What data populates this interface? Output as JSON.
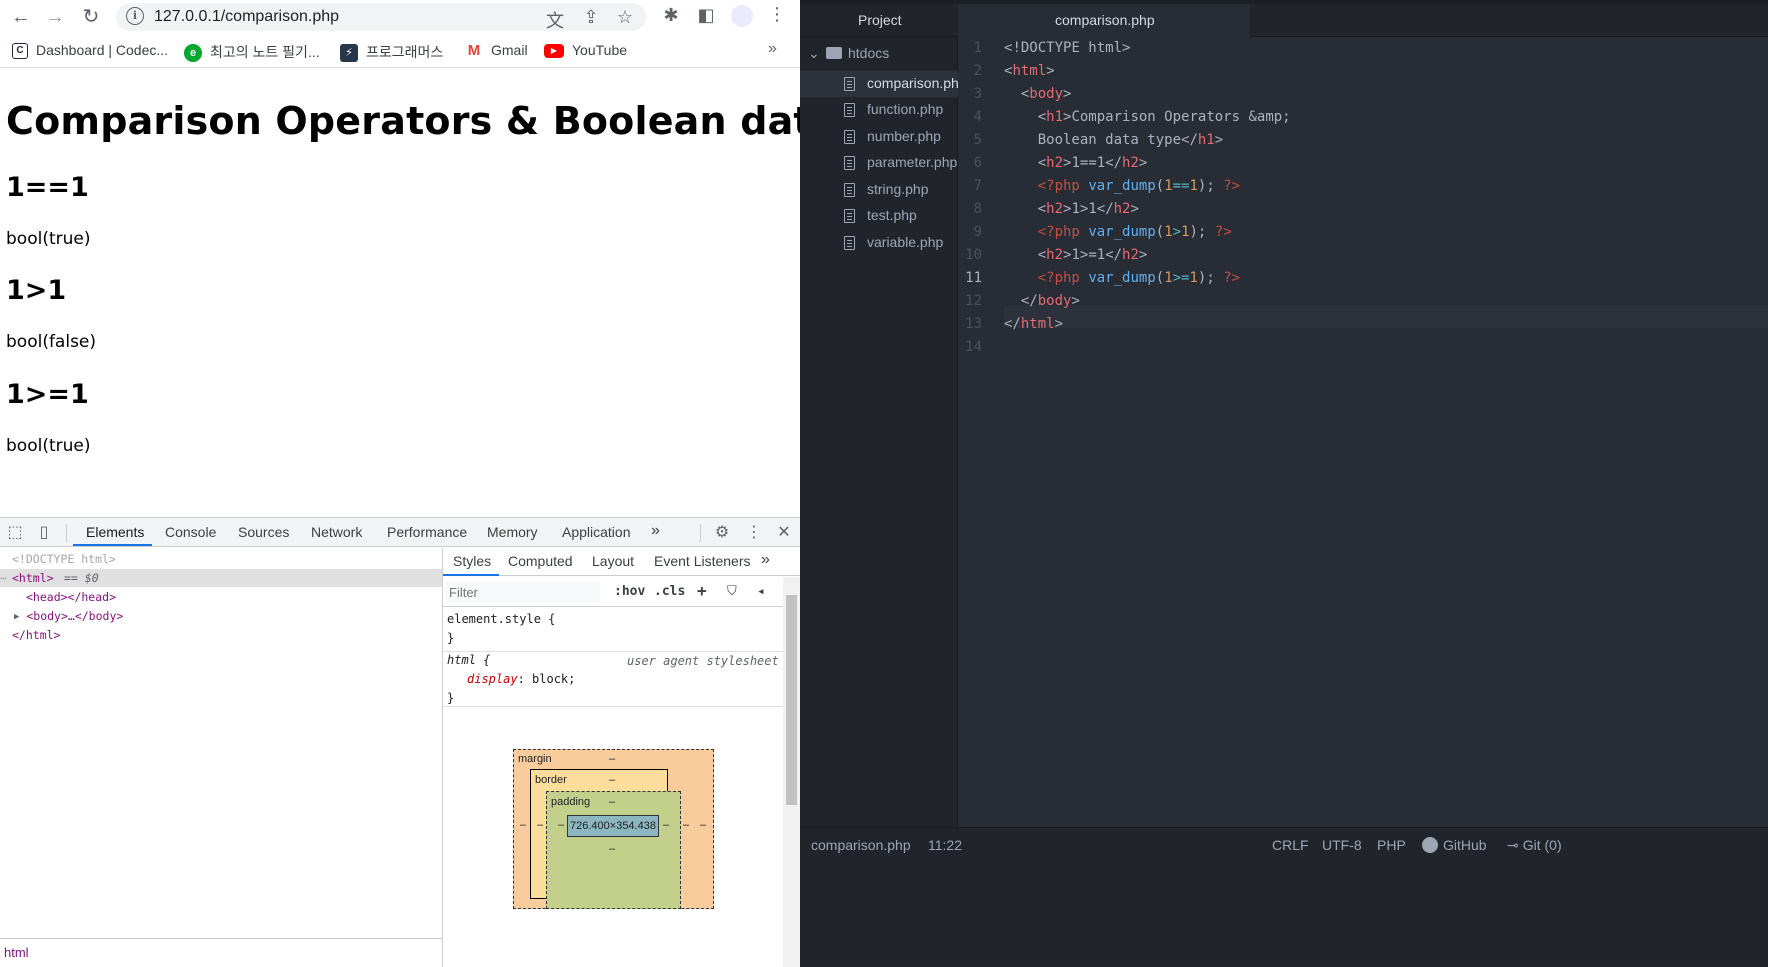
{
  "browser": {
    "url": "127.0.0.1/comparison.php",
    "bookmarks": [
      {
        "label": "Dashboard | Codec...",
        "icon": "codecademy-icon"
      },
      {
        "label": "최고의 노트 필기...",
        "icon": "evernote-icon"
      },
      {
        "label": "프로그래머스",
        "icon": "programmers-icon"
      },
      {
        "label": "Gmail",
        "icon": "gmail-icon"
      },
      {
        "label": "YouTube",
        "icon": "youtube-icon"
      }
    ],
    "bookmarks_more": "»"
  },
  "page": {
    "h1": "Comparison Operators & Boolean data type",
    "sections": [
      {
        "heading": "1==1",
        "output": "bool(true)"
      },
      {
        "heading": "1>1",
        "output": "bool(false)"
      },
      {
        "heading": "1>=1",
        "output": "bool(true)"
      }
    ]
  },
  "devtools": {
    "tabs": [
      "Elements",
      "Console",
      "Sources",
      "Network",
      "Performance",
      "Memory",
      "Application"
    ],
    "active_tab": "Elements",
    "tabs_more": "»",
    "dom": {
      "doctype": "<!DOCTYPE html>",
      "html_open": "<html>",
      "selected_marker": "== $0",
      "head": "<head></head>",
      "body": "<body>…</body>",
      "html_close": "</html>"
    },
    "breadcrumb": "html",
    "styles": {
      "tabs": [
        "Styles",
        "Computed",
        "Layout",
        "Event Listeners"
      ],
      "tabs_more": "»",
      "filter_placeholder": "Filter",
      "hov": ":hov",
      "cls": ".cls",
      "element_style_selector": "element.style {",
      "close_brace": "}",
      "rule_selector": "html {",
      "rule_source": "user agent stylesheet",
      "rule_prop": "display",
      "rule_value": "block;",
      "boxmodel": {
        "margin_label": "margin",
        "border_label": "border",
        "padding_label": "padding",
        "dash": "–",
        "content_size": "726.400×354.438"
      }
    }
  },
  "editor": {
    "panel_title": "Project",
    "active_tab": "comparison.php",
    "folder": "htdocs",
    "files": [
      "comparison.php",
      "function.php",
      "number.php",
      "parameter.php",
      "string.php",
      "test.php",
      "variable.php"
    ],
    "selected_file": "comparison.php",
    "line_numbers": [
      "1",
      "2",
      "3",
      "4",
      "5",
      "6",
      "7",
      "8",
      "9",
      "10",
      "11",
      "12",
      "13",
      "14"
    ],
    "current_line": "11",
    "code": [
      "<!DOCTYPE html>",
      "<html>",
      "  <body>",
      "    <h1>Comparison Operators &amp;",
      "    Boolean data type</h1>",
      "    <h2>1==1</h2>",
      "    <?php var_dump(1==1); ?>",
      "    <h2>1>1</h2>",
      "    <?php var_dump(1>1); ?>",
      "    <h2>1>=1</h2>",
      "    <?php var_dump(1>=1); ?>",
      "  </body>",
      "</html>",
      ""
    ],
    "status": {
      "file": "comparison.php",
      "cursor": "11:22",
      "line_ending": "CRLF",
      "encoding": "UTF-8",
      "grammar": "PHP",
      "github": "GitHub",
      "git": "Git (0)"
    }
  }
}
